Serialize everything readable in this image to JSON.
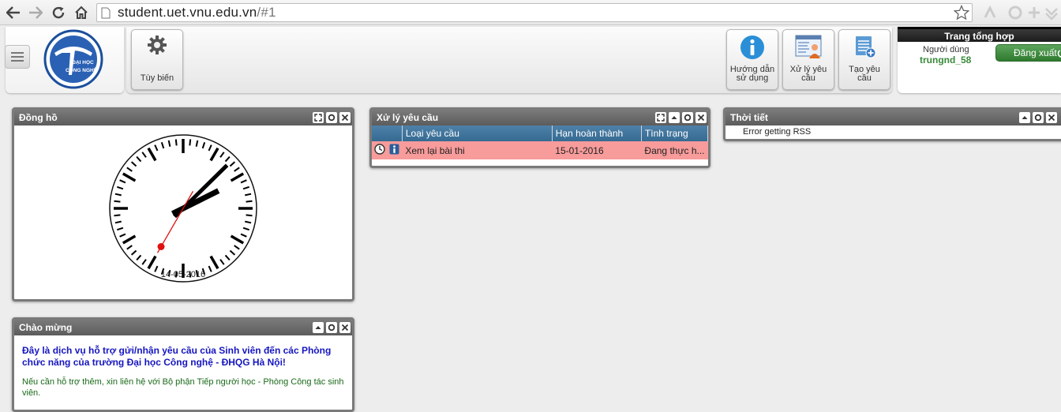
{
  "browser": {
    "url_host": "student.uet.vnu.edu.vn",
    "url_path": "/#1"
  },
  "header": {
    "customize_label": "Tùy biến",
    "tools": [
      {
        "label_1": "Hướng dẫn",
        "label_2": "sử dụng"
      },
      {
        "label_1": "Xử lý yêu",
        "label_2": "cầu"
      },
      {
        "label_1": "Tạo yêu",
        "label_2": "cầu"
      }
    ],
    "userbox": {
      "title": "Trang tổng hợp",
      "user_label": "Người dùng",
      "username": "trungnd_58",
      "logout_label": "Đăng xuất"
    },
    "logo_text_1": "ĐẠI HỌC",
    "logo_text_2": "CÔNG NGHỆ"
  },
  "widgets": {
    "clock": {
      "title": "Đồng hồ",
      "date": "14-05-2016",
      "time": {
        "hour": 2,
        "minute": 7,
        "second": 35
      }
    },
    "requests": {
      "title": "Xử lý yêu cầu",
      "columns": [
        "Loại yêu cầu",
        "Hạn hoàn thành",
        "Tình trạng"
      ],
      "rows": [
        {
          "type": "Xem lại bài thi",
          "deadline": "15-01-2016",
          "status": "Đang thực h..."
        }
      ]
    },
    "weather": {
      "title": "Thời tiết",
      "message": "Error getting RSS"
    },
    "welcome": {
      "title": "Chào mừng",
      "line_1": "Đây là dịch vụ hỗ trợ gửi/nhận yêu cầu của Sinh viên đến các Phòng",
      "line_2": "chức năng của trường Đại học Công nghệ - ĐHQG Hà Nội!",
      "sub_1": "Nếu cần hỗ trợ thêm, xin liên hệ với Bộ phận Tiếp người học - Phòng Công tác sinh",
      "sub_2": "viên."
    }
  },
  "colors": {
    "widget_border": "#7a7a7a",
    "table_header": "#3f7199",
    "row_highlight": "#f79b9b",
    "welcome_text": "#1616c0",
    "username": "#3a8a3a",
    "clock_second_hand": "#e01010"
  }
}
